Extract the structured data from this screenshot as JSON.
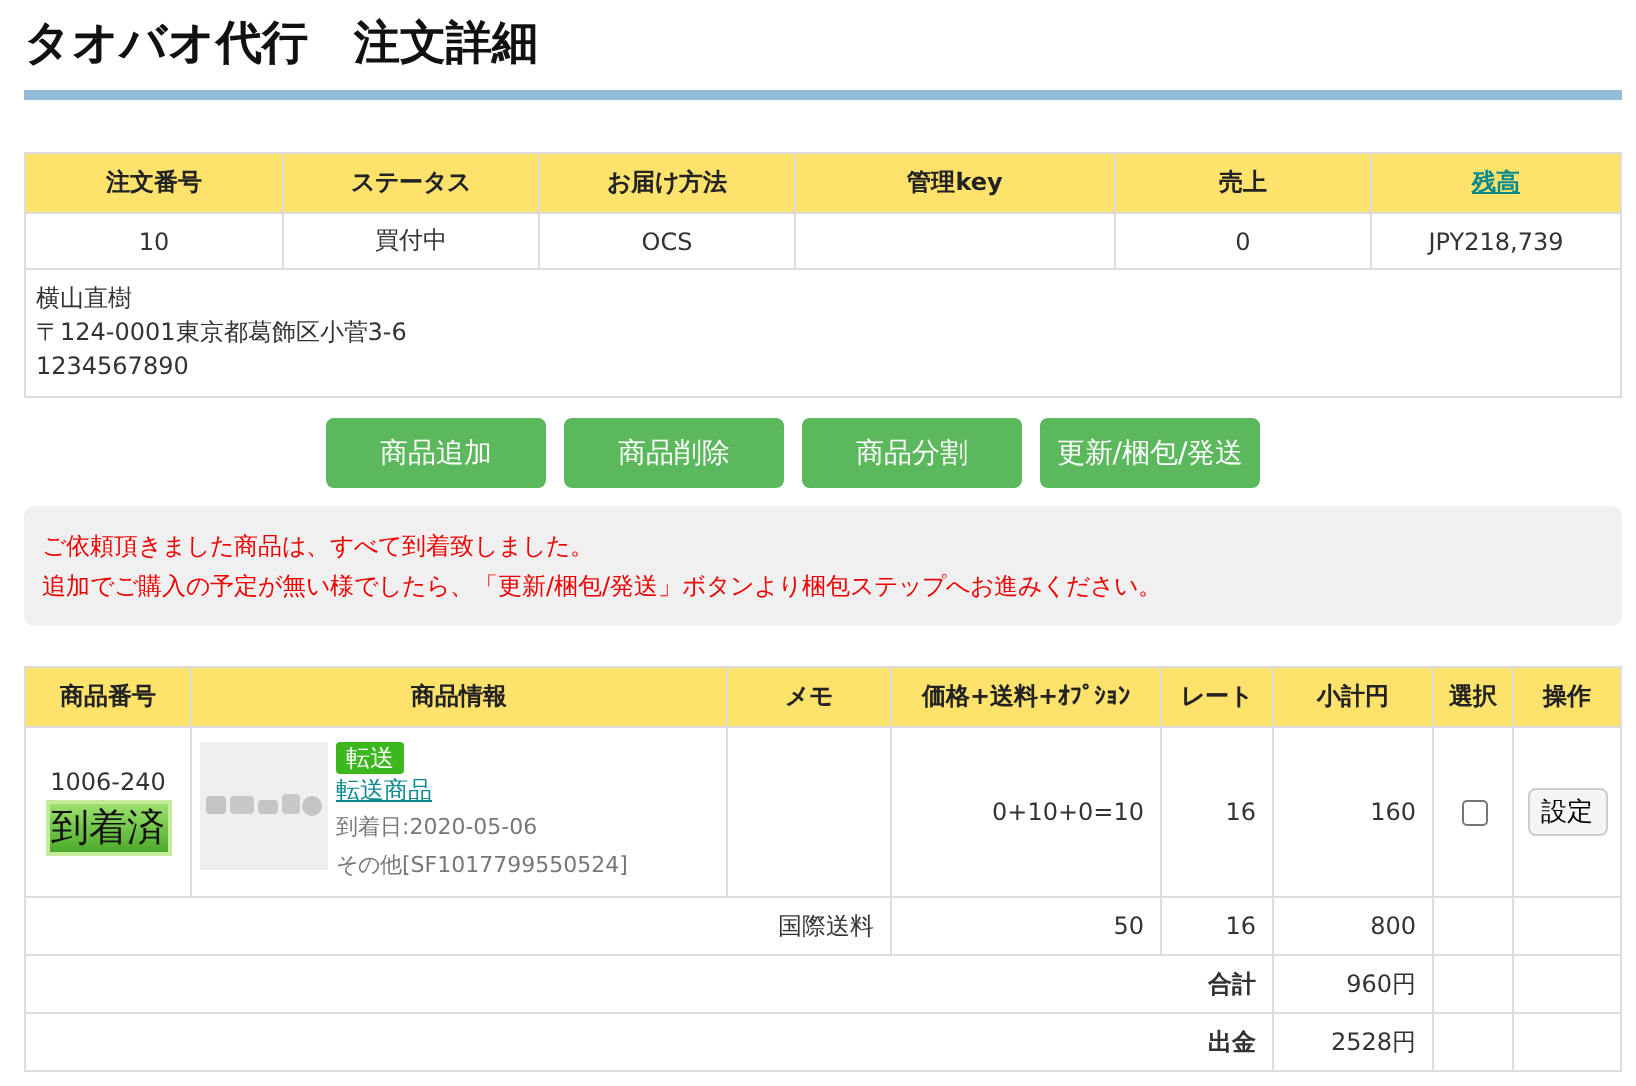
{
  "title": "タオバオ代行　注文詳細",
  "order_table": {
    "columns": [
      {
        "label": "注文番号",
        "link": false
      },
      {
        "label": "ステータス",
        "link": false
      },
      {
        "label": "お届け方法",
        "link": false
      },
      {
        "label": "管理key",
        "link": false
      },
      {
        "label": "売上",
        "link": false
      },
      {
        "label": "残高",
        "link": true
      }
    ],
    "row": {
      "order_number": "10",
      "status": "買付中",
      "delivery": "OCS",
      "sales": "0",
      "balance": "JPY218,739"
    },
    "address": [
      "横山直樹",
      "〒124-0001東京都葛飾区小菅3-6",
      "1234567890"
    ]
  },
  "buttons": [
    "商品追加",
    "商品削除",
    "商品分割",
    "更新/梱包/発送"
  ],
  "notice": [
    "ご依頼頂きました商品は、すべて到着致しました。",
    "追加でご購入の予定が無い様でしたら、「更新/梱包/発送」ボタンより梱包ステップへお進みください。"
  ],
  "items_table": {
    "columns": [
      "商品番号",
      "商品情報",
      "メモ",
      "価格+送料+ｵﾌﾟｼｮﾝ",
      "レート",
      "小計円",
      "選択",
      "操作"
    ],
    "items": [
      {
        "number": "1006-240",
        "status": "到着済",
        "tag": "転送",
        "name": "転送商品",
        "arrival": "到着日:2020-05-06",
        "other": "その他[SF1017799550524]",
        "price": "0+10+0=10",
        "rate": "16",
        "subtotal": "160",
        "checked": false,
        "action": "設定"
      }
    ],
    "shipping": {
      "label": "国際送料",
      "price": "50",
      "rate": "16",
      "subtotal": "800"
    },
    "totals": [
      {
        "label": "合計",
        "value": "960円"
      },
      {
        "label": "出金",
        "value": "2528円"
      }
    ]
  }
}
